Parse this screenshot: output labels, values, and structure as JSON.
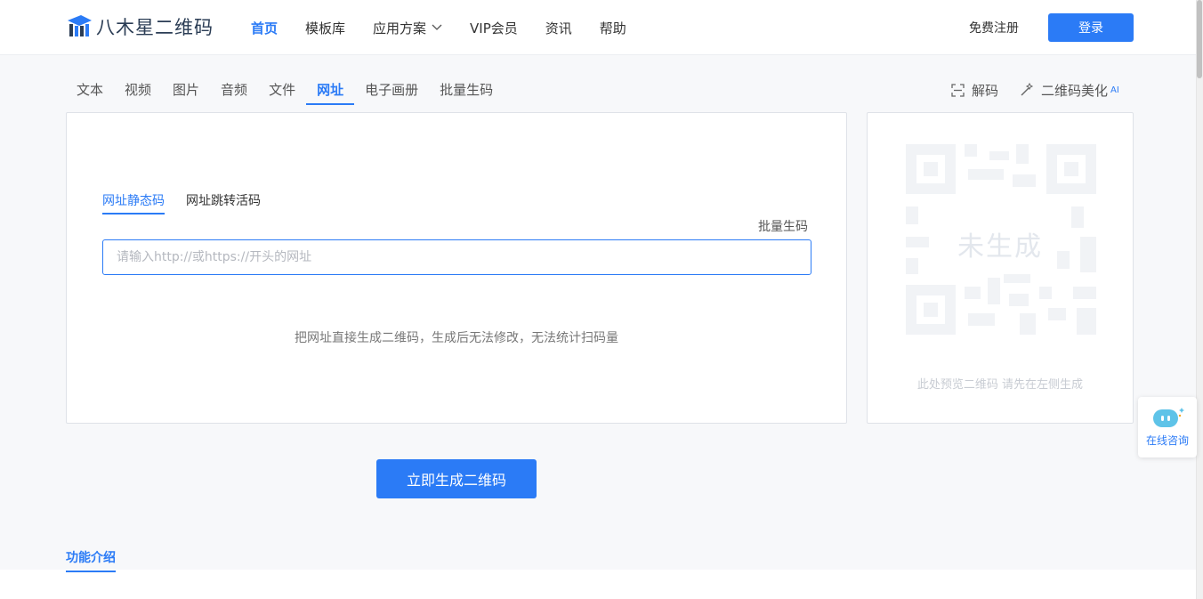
{
  "header": {
    "logo_text": "八木星二维码",
    "nav": [
      {
        "label": "首页",
        "active": true
      },
      {
        "label": "模板库"
      },
      {
        "label": "应用方案",
        "has_dropdown": true
      },
      {
        "label": "VIP会员"
      },
      {
        "label": "资讯"
      },
      {
        "label": "帮助"
      }
    ],
    "register_label": "免费注册",
    "login_label": "登录"
  },
  "type_tabs": [
    "文本",
    "视频",
    "图片",
    "音频",
    "文件",
    "网址",
    "电子画册",
    "批量生码"
  ],
  "active_type_tab": "网址",
  "tools": {
    "decode_label": "解码",
    "beautify_label": "二维码美化",
    "beautify_badge": "AI"
  },
  "editor": {
    "subtabs": [
      "网址静态码",
      "网址跳转活码"
    ],
    "active_subtab": "网址静态码",
    "batch_label": "批量生码",
    "input_value": "",
    "input_placeholder": "请输入http://或https://开头的网址",
    "hint": "把网址直接生成二维码，生成后无法修改，无法统计扫码量"
  },
  "preview": {
    "placeholder_label": "未生成",
    "hint": "此处预览二维码 请先在左侧生成"
  },
  "generate_label": "立即生成二维码",
  "section_title": "功能介绍",
  "chat": {
    "label": "在线咨询"
  },
  "colors": {
    "accent": "#2b7bf6",
    "background": "#f7f8fa"
  }
}
